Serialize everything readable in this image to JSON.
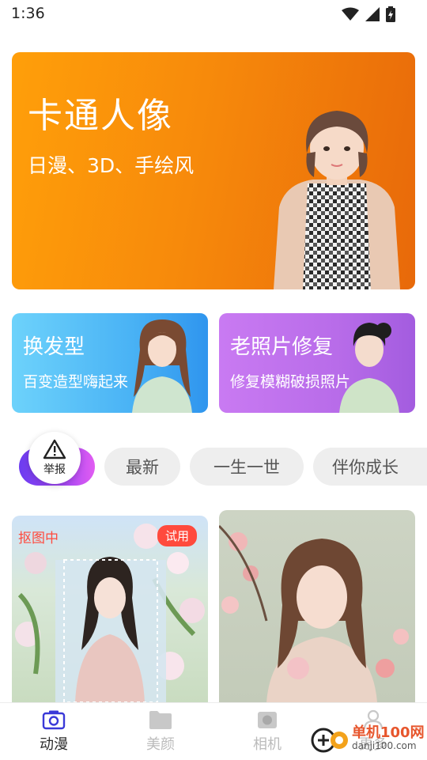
{
  "status": {
    "time": "1:36"
  },
  "hero": {
    "title": "卡通人像",
    "subtitle": "日漫、3D、手绘风"
  },
  "cards": [
    {
      "title": "换发型",
      "subtitle": "百变造型嗨起来"
    },
    {
      "title": "老照片修复",
      "subtitle": "修复模糊破损照片"
    }
  ],
  "report": {
    "label": "举报"
  },
  "chips": [
    "最新",
    "一生一世",
    "伴你成长"
  ],
  "gallery": {
    "cutout_label": "抠图中",
    "trial_label": "试用"
  },
  "nav": {
    "items": [
      {
        "label": "动漫",
        "icon": "camera-icon"
      },
      {
        "label": "美颜",
        "icon": "folder-icon"
      },
      {
        "label": "相机",
        "icon": "camera-shutter-icon"
      },
      {
        "label": "更多",
        "icon": "user-icon"
      }
    ]
  },
  "watermark": {
    "line1": "单机100网",
    "line2": "danji100.com"
  },
  "colors": {
    "hero": "#f78a0b",
    "hair_card": "#4ab3f5",
    "photo_card": "#b86ce9",
    "active_chip": "#a547f3",
    "badge": "#ff4a3d",
    "nav_active": "#2b2b2b"
  }
}
